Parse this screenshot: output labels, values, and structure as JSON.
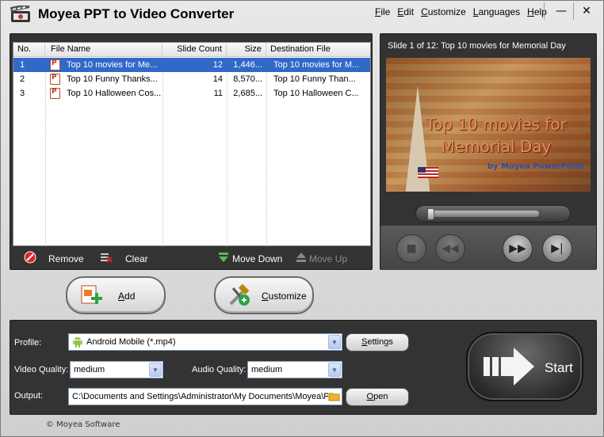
{
  "window": {
    "title": "Moyea PPT to Video Converter",
    "minimize_glyph": "—",
    "close_glyph": "✕"
  },
  "menu": [
    "File",
    "Edit",
    "Customize",
    "Languages",
    "Help"
  ],
  "file_list": {
    "columns": [
      "No.",
      "File Name",
      "Slide Count",
      "Size",
      "Destination File"
    ],
    "rows": [
      {
        "no": "1",
        "name": "Top 10 movies for Me...",
        "slides": "12",
        "size": "1,446...",
        "dest": "Top 10 movies for M...",
        "selected": true
      },
      {
        "no": "2",
        "name": "Top 10 Funny Thanks...",
        "slides": "14",
        "size": "8,570...",
        "dest": "Top 10 Funny Than...",
        "selected": false
      },
      {
        "no": "3",
        "name": "Top 10 Halloween Cos...",
        "slides": "11",
        "size": "2,685...",
        "dest": "Top 10 Halloween C...",
        "selected": false
      }
    ]
  },
  "list_toolbar": {
    "remove": "Remove",
    "clear": "Clear",
    "move_down": "Move Down",
    "move_up": "Move Up"
  },
  "preview": {
    "caption": "Slide 1 of 12: Top 10 movies for Memorial Day",
    "slide_title": "Top 10 movies for Memorial Day",
    "slide_byline": "by Moyea PowerPoint",
    "seek_position": 0
  },
  "actions": {
    "add": "Add",
    "customize": "Customize"
  },
  "settings": {
    "profile_label": "Profile:",
    "profile_value": "Android Mobile (*.mp4)",
    "settings_button": "Settings",
    "video_quality_label": "Video Quality:",
    "video_quality_value": "medium",
    "audio_quality_label": "Audio Quality:",
    "audio_quality_value": "medium",
    "output_label": "Output:",
    "output_value": "C:\\Documents and Settings\\Administrator\\My Documents\\Moyea\\PF",
    "open_button": "Open",
    "start_button": "Start"
  },
  "footer": {
    "copyright": "© Moyea Software"
  },
  "colors": {
    "selection": "#3169c6",
    "panel_dark": "#333333"
  }
}
